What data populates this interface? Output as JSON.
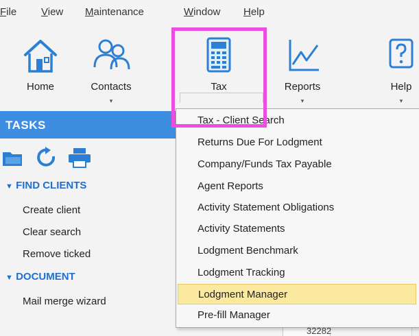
{
  "menubar": {
    "file": {
      "first": "F",
      "rest": "ile"
    },
    "view": {
      "first": "V",
      "rest": "iew"
    },
    "maintenance": {
      "first": "M",
      "rest": "aintenance"
    },
    "window": {
      "first": "W",
      "rest": "indow"
    },
    "help": {
      "first": "H",
      "rest": "elp"
    }
  },
  "ribbon": {
    "buttons": [
      {
        "label": "Home",
        "icon": "house-icon",
        "has_dropdown": false
      },
      {
        "label": "Contacts",
        "icon": "people-icon",
        "has_dropdown": true
      },
      {
        "label": "Tax",
        "icon": "calculator-icon",
        "has_dropdown": true
      },
      {
        "label": "Reports",
        "icon": "line-chart-icon",
        "has_dropdown": true
      },
      {
        "label": "Help",
        "icon": "question-icon",
        "has_dropdown": true
      }
    ],
    "dropdown_arrow": "▾"
  },
  "tasks": {
    "header": "TASKS",
    "icons": [
      "folder-icon",
      "refresh-icon",
      "print-icon"
    ],
    "sections": [
      {
        "title": "FIND CLIENTS",
        "links": [
          "Create client",
          "Clear search",
          "Remove ticked"
        ]
      },
      {
        "title": "DOCUMENT",
        "links": [
          "Mail merge wizard"
        ]
      }
    ],
    "section_arrow": "▼"
  },
  "tax_menu": {
    "items": [
      "Tax - Client Search",
      "Returns Due For Lodgment",
      "Company/Funds Tax Payable",
      "Agent Reports",
      "Activity Statement Obligations",
      "Activity Statements",
      "Lodgment Benchmark",
      "Lodgment Tracking",
      "Lodgment Manager",
      "Pre-fill Manager"
    ],
    "selected": "Lodgment Manager"
  },
  "background": {
    "partial_value": "32282"
  },
  "colors": {
    "highlight": "#ec4fe0",
    "tasks_header": "#3d8de0",
    "section_title": "#1f6fd1",
    "selected_item": "#fbe9a0",
    "icon_blue": "#2d7fd3"
  }
}
